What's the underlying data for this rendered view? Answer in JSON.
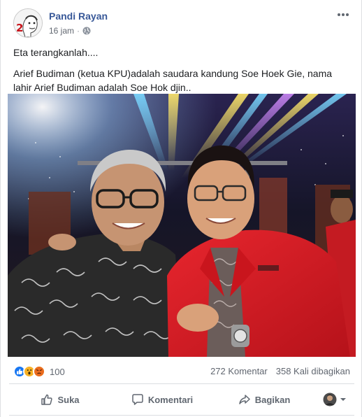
{
  "post": {
    "author": "Pandi Rayan",
    "avatar_badge": "2",
    "timestamp": "16 jam",
    "audience_icon": "globe-icon",
    "menu_icon": "more-options-icon",
    "text_lines": [
      "Eta terangkanlah....",
      "Arief Budiman (ketua KPU)adalah saudara kandung Soe Hoek Gie, nama lahir Arief Budiman adalah Soe Hok djin.."
    ]
  },
  "stats": {
    "reactions": [
      "like",
      "wow",
      "angry"
    ],
    "reaction_count": "100",
    "comments": "272 Komentar",
    "shares": "358 Kali dibagikan"
  },
  "actions": {
    "like_label": "Suka",
    "comment_label": "Komentari",
    "share_label": "Bagikan"
  },
  "colors": {
    "link": "#385898",
    "secondary_text": "#616770",
    "like_blue": "#1877f2",
    "wow_yellow": "#f7b125",
    "angry_orange": "#e9710f",
    "jacket_red": "#d81f26"
  }
}
